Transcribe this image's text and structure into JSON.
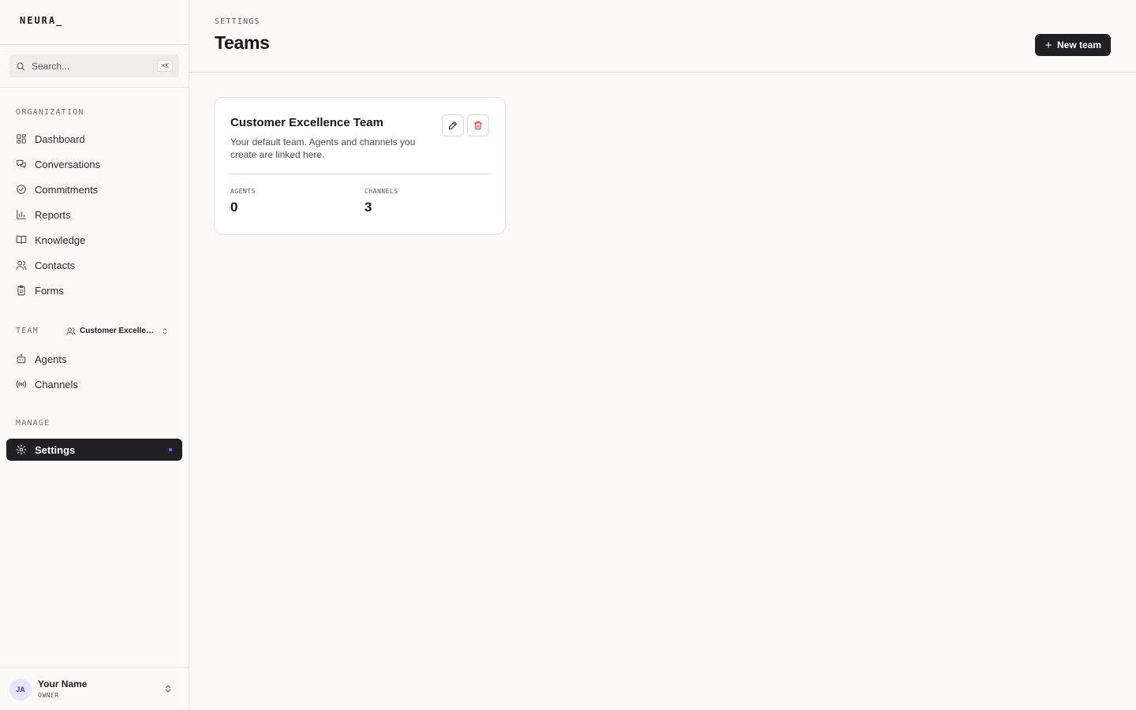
{
  "brand": {
    "logo": "NEURA_"
  },
  "search": {
    "placeholder": "Search...",
    "shortcut": "⌘K"
  },
  "sidebar": {
    "organization_label": "ORGANIZATION",
    "organization_items": [
      {
        "label": "Dashboard",
        "icon": "dashboard-icon"
      },
      {
        "label": "Conversations",
        "icon": "chat-icon"
      },
      {
        "label": "Commitments",
        "icon": "check-circle-icon"
      },
      {
        "label": "Reports",
        "icon": "bar-chart-icon"
      },
      {
        "label": "Knowledge",
        "icon": "book-icon"
      },
      {
        "label": "Contacts",
        "icon": "users-icon"
      },
      {
        "label": "Forms",
        "icon": "clipboard-icon"
      }
    ],
    "team_label": "TEAM",
    "team_switcher": {
      "label": "Customer Excellence Team",
      "icon": "users-icon"
    },
    "team_items": [
      {
        "label": "Agents",
        "icon": "bot-icon"
      },
      {
        "label": "Channels",
        "icon": "radio-icon"
      }
    ],
    "manage_label": "MANAGE",
    "manage_items": [
      {
        "label": "Settings",
        "icon": "gear-icon",
        "active": true
      }
    ]
  },
  "user": {
    "initials": "JA",
    "name": "Your Name",
    "role": "OWNER"
  },
  "header": {
    "eyebrow": "SETTINGS",
    "title": "Teams",
    "new_button": "New team"
  },
  "teams": [
    {
      "name": "Customer Excellence Team",
      "description": "Your default team. Agents and channels you create are linked here.",
      "stats": [
        {
          "label": "AGENTS",
          "value": "0"
        },
        {
          "label": "CHANNELS",
          "value": "3"
        }
      ]
    }
  ],
  "colors": {
    "accent_dark": "#1f1f24",
    "active_dot": "#6d74ff",
    "delete_red": "#d92d2d",
    "background": "#fbfaf7"
  }
}
